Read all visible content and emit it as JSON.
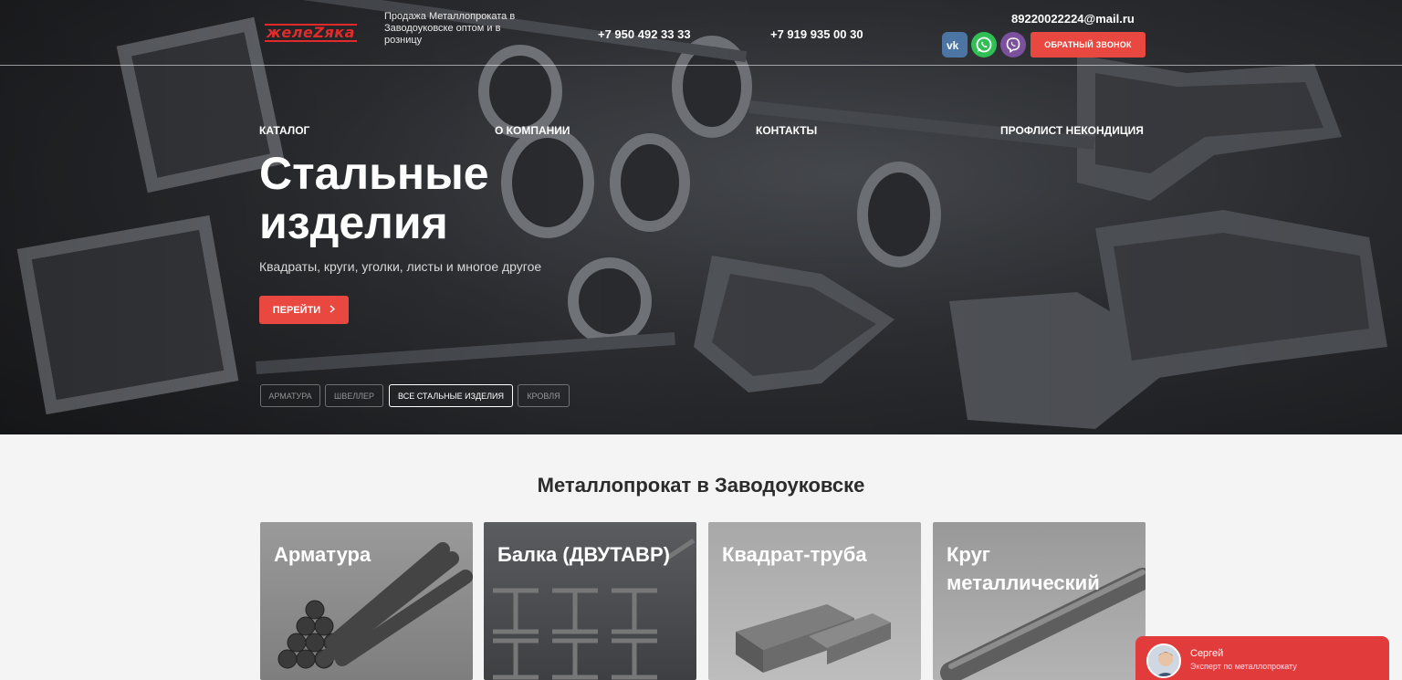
{
  "header": {
    "logo_text": "жeлeZяка",
    "tagline": "Продажа Металлопроката в Заводоуковске оптом и в розницу",
    "phone1": "+7 950 492 33 33",
    "phone2": "+7 919 935 00 30",
    "email": "89220022224@mail.ru",
    "callback_label": "ОБРАТНЫЙ ЗВОНОК",
    "social_icons": [
      "vk-icon",
      "whatsapp-icon",
      "viber-icon"
    ]
  },
  "nav": {
    "items": [
      "КАТАЛОГ",
      "О КОМПАНИИ",
      "КОНТАКТЫ",
      "ПРОФЛИСТ НЕКОНДИЦИЯ"
    ]
  },
  "hero": {
    "title": "Стальные изделия",
    "subtitle": "Квадраты, круги, уголки, листы и многое другое",
    "button_label": "ПЕРЕЙТИ",
    "button_icon": "chevron-right-icon",
    "chips": [
      "АРМАТУРА",
      "ШВЕЛЛЕР",
      "ВСЕ СТАЛЬНЫЕ ИЗДЕЛИЯ",
      "КРОВЛЯ"
    ],
    "active_chip": "ВСЕ СТАЛЬНЫЕ ИЗДЕЛИЯ"
  },
  "catalog": {
    "title": "Металлопрокат в Заводоуковске",
    "cards": [
      "Арматура",
      "Балка (ДВУТАВР)",
      "Квадрат-труба",
      "Круг металлический"
    ]
  },
  "chat": {
    "name": "Сергей",
    "role": "Эксперт по металлопрокату"
  },
  "colors": {
    "accent": "#e8483f",
    "logo_red": "#e12b2b",
    "chat_red": "#e23b3b"
  }
}
